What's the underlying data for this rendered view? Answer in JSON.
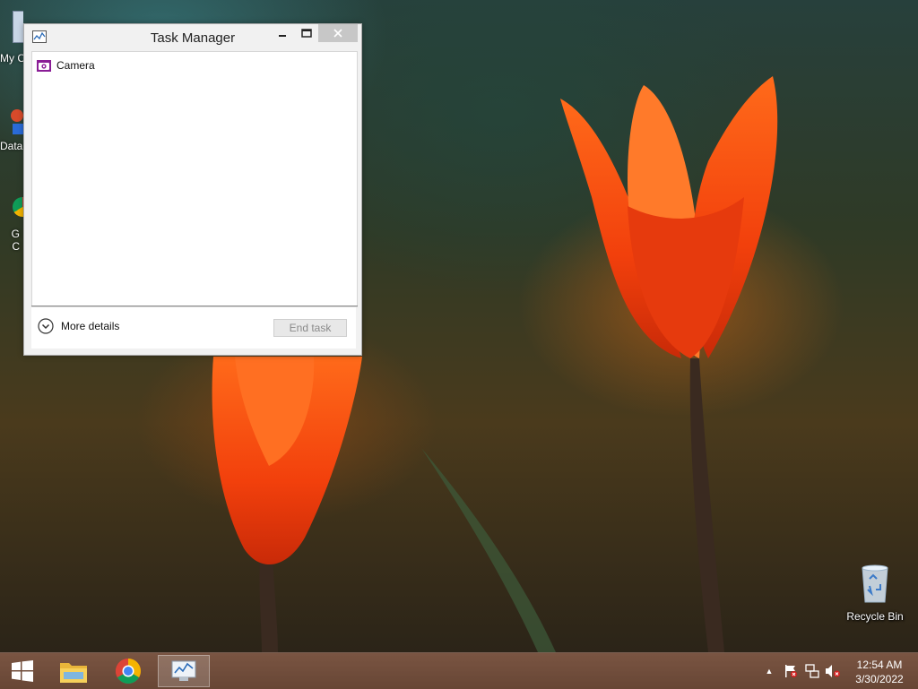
{
  "desktop": {
    "partial_icons": [
      {
        "name": "my-computer",
        "label": "My C"
      },
      {
        "name": "data",
        "label": "Data"
      },
      {
        "name": "google-chrome-line1",
        "label": "G"
      },
      {
        "name": "google-chrome-line2",
        "label": "C"
      }
    ],
    "recycle_bin": {
      "label": "Recycle Bin",
      "icon": "recycle-bin-icon"
    }
  },
  "task_manager": {
    "title": "Task Manager",
    "controls": {
      "minimize": "minimize-icon",
      "maximize": "maximize-icon",
      "close": "close-icon"
    },
    "processes": [
      {
        "name": "Camera",
        "icon": "camera-icon",
        "icon_color": "#8a1d96"
      }
    ],
    "more_details_label": "More details",
    "end_task_label": "End task"
  },
  "taskbar": {
    "pinned": [
      {
        "name": "start-button",
        "icon": "windows-logo-icon"
      },
      {
        "name": "file-explorer",
        "icon": "folder-icon"
      },
      {
        "name": "google-chrome",
        "icon": "chrome-icon"
      },
      {
        "name": "task-manager",
        "icon": "task-manager-icon",
        "active": true
      }
    ],
    "tray": {
      "show_hidden": "up-arrow-icon",
      "action_center": "flag-icon",
      "network": "network-icon",
      "volume": "volume-muted-icon"
    },
    "clock": {
      "time": "12:54 AM",
      "date": "3/30/2022"
    }
  },
  "colors": {
    "accent_close": "#c7c7c7",
    "taskbar": "#6b4533"
  }
}
